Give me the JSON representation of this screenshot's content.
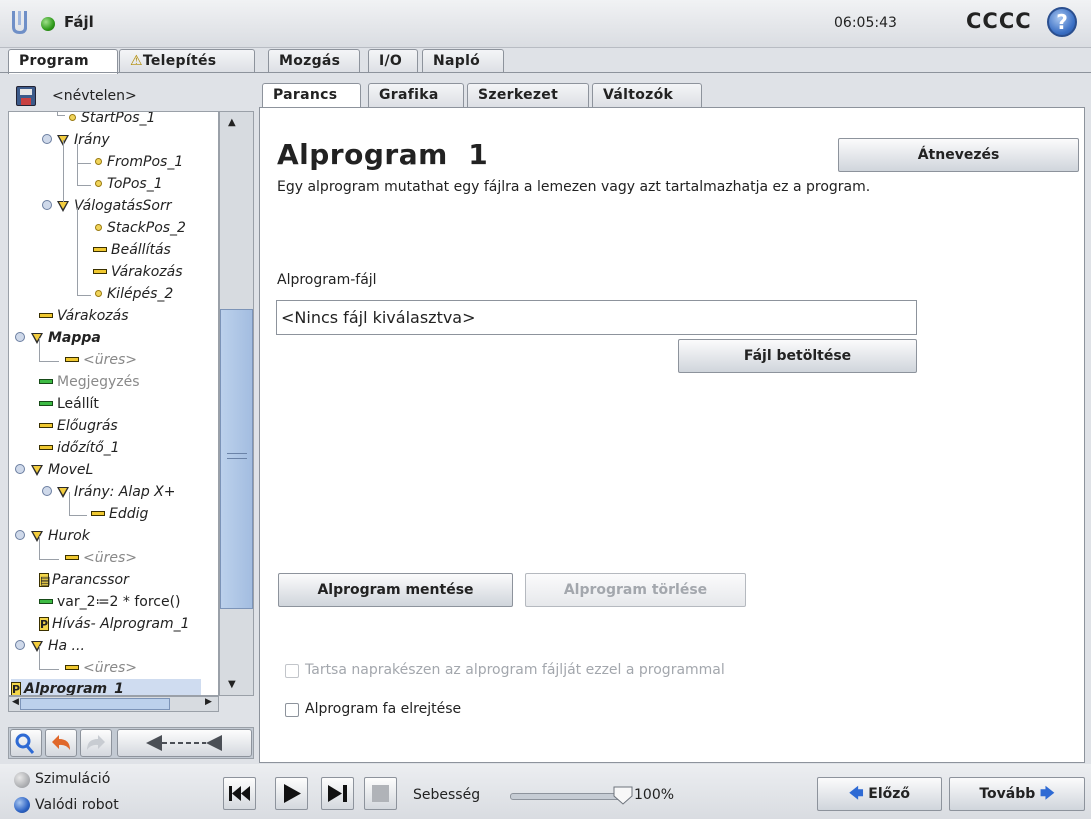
{
  "header": {
    "menu_file": "Fájl",
    "clock": "06:05:43",
    "robot_name": "CCCC",
    "help": "?"
  },
  "main_tabs": [
    "Program",
    "Telepítés",
    "Mozgás",
    "I/O",
    "Napló"
  ],
  "sub_tabs": [
    "Parancs",
    "Grafika",
    "Szerkezet",
    "Változók"
  ],
  "left": {
    "filename": "<névtelen>",
    "tree": [
      {
        "label": "StartPos_1",
        "italic": true
      },
      {
        "label": "Irány",
        "italic": true
      },
      {
        "label": "FromPos_1",
        "italic": true
      },
      {
        "label": "ToPos_1",
        "italic": true
      },
      {
        "label": "ValogatasSorr",
        "display": "VálogatásSorr",
        "italic": true
      },
      {
        "label": "StackPos_2",
        "italic": true
      },
      {
        "label": "Beállítás",
        "italic": true
      },
      {
        "label": "Várakozás",
        "italic": true
      },
      {
        "label": "Kilépés_2",
        "italic": true
      },
      {
        "label": "Várakozás",
        "italic": true
      },
      {
        "label": "Mappa",
        "italic": true,
        "bold": true
      },
      {
        "label": "<üres>",
        "italic": true
      },
      {
        "label": "Megjegyzés"
      },
      {
        "label": "Leállít"
      },
      {
        "label": "Előugrás",
        "italic": true
      },
      {
        "label": "időzítő_1",
        "italic": true
      },
      {
        "label": "MoveL",
        "italic": true
      },
      {
        "label": "Irány: Alap X+",
        "italic": true
      },
      {
        "label": "Eddig",
        "italic": true
      },
      {
        "label": "Hurok",
        "italic": true
      },
      {
        "label": "<üres>",
        "italic": true
      },
      {
        "label": "Parancssor",
        "italic": true
      },
      {
        "label": "var_2≔2 * force()"
      },
      {
        "label": "Hívás- Alprogram_1",
        "italic": true
      },
      {
        "label": "Ha ...",
        "italic": true
      },
      {
        "label": "<üres>",
        "italic": true
      },
      {
        "label": "Alprogram_1",
        "italic": true,
        "bold": true
      }
    ]
  },
  "content": {
    "title": "Alprogram  1",
    "description": "Egy alprogram mutathat egy fájlra a lemezen vagy azt tartalmazhatja ez a program.",
    "rename_button": "Átnevezés",
    "file_label": "Alprogram-fájl",
    "file_value": "<Nincs fájl kiválasztva>",
    "load_button": "Fájl betöltése",
    "save_button": "Alprogram mentése",
    "delete_button": "Alprogram törlése",
    "keep_updated_label": "Tartsa naprakészen az alprogram fájlját ezzel a programmal",
    "hide_tree_label": "Alprogram fa elrejtése"
  },
  "footer": {
    "simulation": "Szimuláció",
    "real_robot": "Valódi robot",
    "speed_label": "Sebesség",
    "speed_value": "100%",
    "speed_fraction": 1.0,
    "prev_button": "Előző",
    "next_button": "Tovább"
  },
  "colors": {
    "accent_blue": "#3a6fc4",
    "status_green": "#2f9a1b",
    "node_yellow": "#f0c830"
  }
}
